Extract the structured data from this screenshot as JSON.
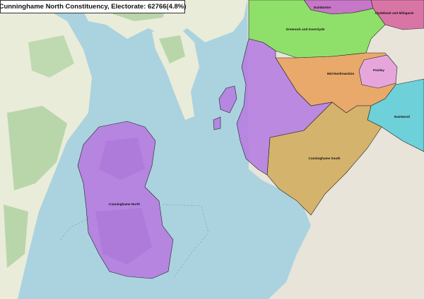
{
  "title": "Cunninghame North Constituency, Electorate: 62766(4.8%)",
  "colors": {
    "sea": "#aad3df",
    "land": "#f2efe9",
    "forest": "#add19e",
    "highlight": "#b67ee0",
    "dumbarton": "#c777c7",
    "clydebank": "#d975a6",
    "inverclyde": "#8fe06a",
    "mid_renfrewshire": "#e9a96b",
    "paisley": "#e6a6dc",
    "eastwood": "#6ed0d8",
    "cunninghame_south": "#d4b36c",
    "border": "#222222"
  },
  "regions": [
    {
      "id": "cunninghame-north",
      "label": "Cunninghame North"
    },
    {
      "id": "dumbarton",
      "label": "Dumbarton"
    },
    {
      "id": "clydebank-milngavie",
      "label": "Clydebank and Milngavie"
    },
    {
      "id": "inverclyde",
      "label": "Greenock and Inverclyde"
    },
    {
      "id": "mid-renfrewshire",
      "label": "Mid Renfrewshire"
    },
    {
      "id": "paisley",
      "label": "Paisley"
    },
    {
      "id": "eastwood",
      "label": "Eastwood"
    },
    {
      "id": "cunninghame-south",
      "label": "Cunninghame South"
    }
  ]
}
